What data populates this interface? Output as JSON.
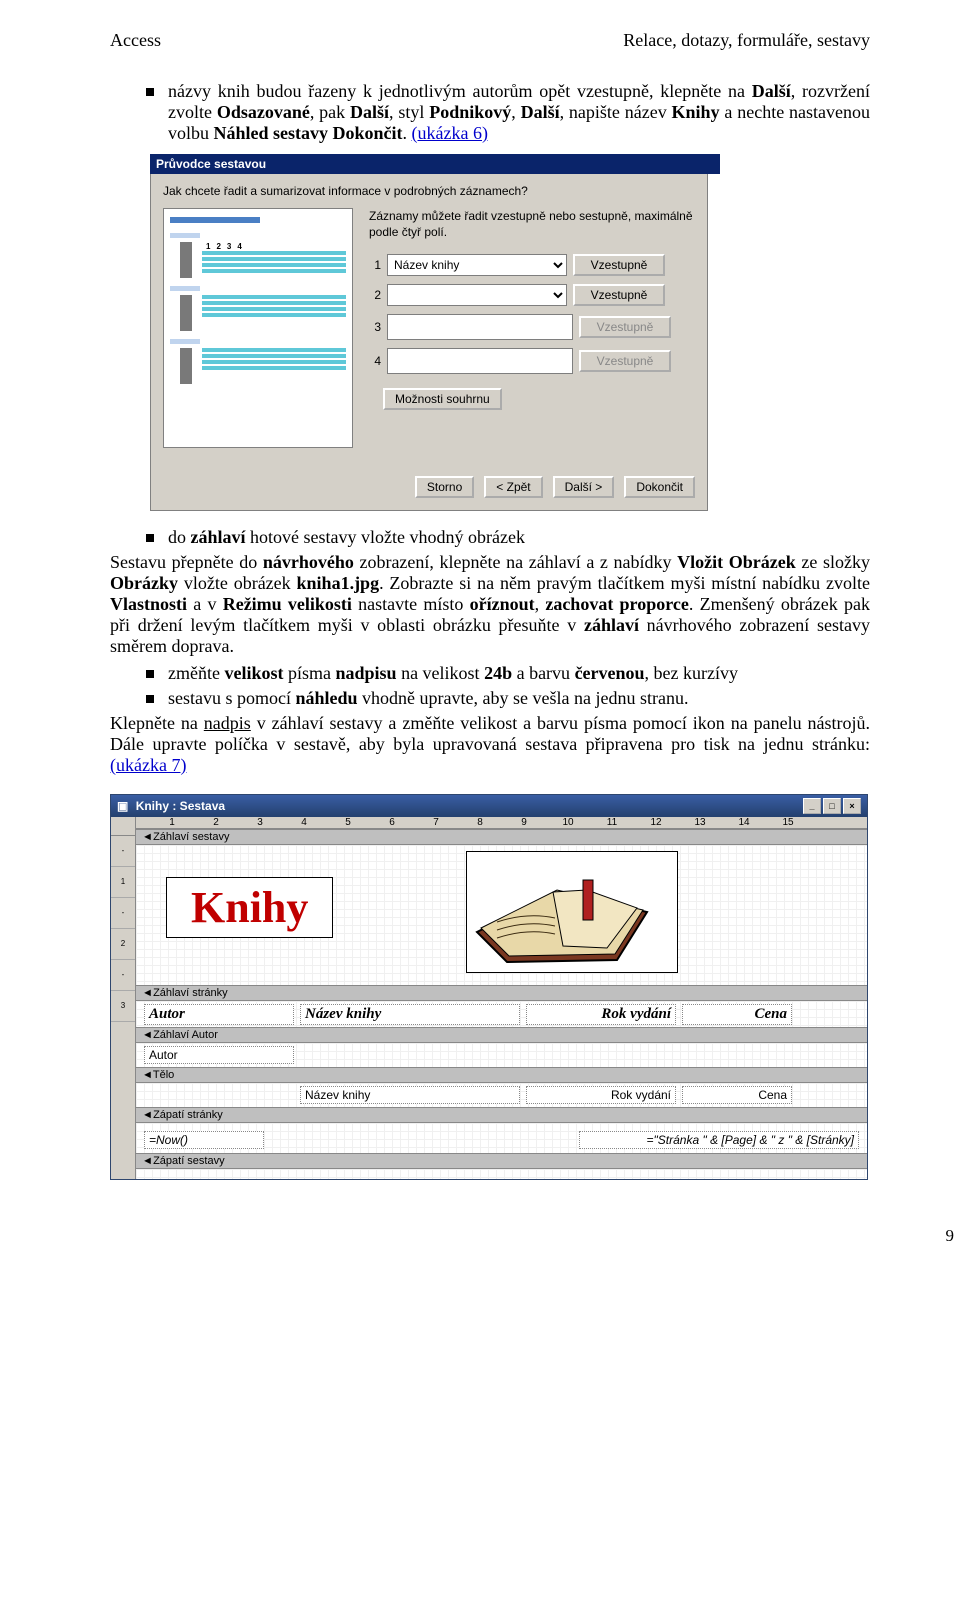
{
  "header": {
    "left": "Access",
    "right": "Relace, dotazy, formuláře, sestavy"
  },
  "bullet1": {
    "pre": "názvy knih budou řazeny k jednotlivým autorům opět vzestupně, klepněte na ",
    "b1": "Další",
    "mid1": ", rozvržení zvolte ",
    "b2": "Odsazované",
    "mid2": ", pak ",
    "b3": "Další",
    "mid3": ", styl ",
    "b4": "Podnikový",
    "mid4": ", ",
    "b5": "Další",
    "mid5": ", napište název ",
    "b6": "Knihy",
    "mid6": " a nechte nastavenou volbu ",
    "b7": "Náhled sestavy Dokončit",
    "post": ". ",
    "link": "(ukázka 6)"
  },
  "wizard": {
    "title": "Průvodce sestavou",
    "question": "Jak chcete řadit a sumarizovat informace v podrobných záznamech?",
    "hint": "Záznamy můžete řadit vzestupně nebo sestupně, maximálně podle čtyř polí.",
    "rows": [
      {
        "n": "1",
        "value": "Název knihy",
        "btn": "Vzestupně",
        "enabled": true
      },
      {
        "n": "2",
        "value": "",
        "btn": "Vzestupně",
        "enabled": true
      },
      {
        "n": "3",
        "value": "",
        "btn": "Vzestupně",
        "enabled": false
      },
      {
        "n": "4",
        "value": "",
        "btn": "Vzestupně",
        "enabled": false
      }
    ],
    "summary": "Možnosti souhrnu",
    "buttons": {
      "cancel": "Storno",
      "back": "< Zpět",
      "next": "Další >",
      "finish": "Dokončit"
    },
    "preview_numbers": [
      "1",
      "2",
      "3",
      "4"
    ]
  },
  "after_wizard": {
    "bullet2_pre": "do ",
    "bullet2_b1": "záhlaví",
    "bullet2_post": " hotové sestavy vložte vhodný obrázek",
    "para1a": "Sestavu přepněte do ",
    "para1b": "návrhového",
    "para1c": " zobrazení, klepněte na záhlaví a z nabídky ",
    "para1d": "Vložit Obrázek",
    "para1e": " ze složky ",
    "para1f": "Obrázky",
    "para1g": " vložte obrázek ",
    "para1h": "kniha1.jpg",
    "para1i": ". Zobrazte si na něm pravým tlačítkem myši místní nabídku zvolte ",
    "para1j": "Vlastnosti",
    "para1k": " a v ",
    "para1l": "Režimu velikosti",
    "para1m": " nastavte místo ",
    "para1n": "oříznout",
    "para1o": ", ",
    "para1p": "zachovat proporce",
    "para1q": ". Zmenšený obrázek pak při držení levým tlačítkem myši v oblasti obrázku přesuňte v ",
    "para1r": "záhlaví",
    "para1s": " návrhového zobrazení sestavy směrem doprava.",
    "bullet3a": "změňte ",
    "bullet3b": "velikost",
    "bullet3c": " písma ",
    "bullet3d": "nadpisu",
    "bullet3e": " na velikost ",
    "bullet3f": "24b",
    "bullet3g": " a barvu ",
    "bullet3h": "červenou",
    "bullet3i": ", bez kurzívy",
    "bullet4a": "sestavu s pomocí ",
    "bullet4b": "náhledu",
    "bullet4c": " vhodně upravte, aby se vešla na jednu stranu.",
    "para2a": "Klepněte na ",
    "para2b": "nadpis",
    "para2c": " v záhlaví sestavy a změňte velikost a barvu písma pomocí ikon na panelu nástrojů. Dále upravte políčka v sestavě, aby byla upravovaná sestava připravena pro tisk na jednu stránku:",
    "para2link": "(ukázka 7)"
  },
  "report": {
    "title": "Knihy : Sestava",
    "win_min": "_",
    "win_max": "□",
    "win_close": "×",
    "ruler": [
      "1",
      "2",
      "3",
      "4",
      "5",
      "6",
      "7",
      "8",
      "9",
      "10",
      "11",
      "12",
      "13",
      "14",
      "15"
    ],
    "vruler": [
      "-",
      "1",
      "-",
      "2",
      "-",
      "3"
    ],
    "sections": {
      "s1": "Záhlaví sestavy",
      "s2": "Záhlaví stránky",
      "s3": "Záhlaví Autor",
      "s4": "Tělo",
      "s5": "Zápatí stránky",
      "s6": "Zápatí sestavy"
    },
    "bigtitle": "Knihy",
    "cols": {
      "c1": "Autor",
      "c2": "Název knihy",
      "c3": "Rok vydání",
      "c4": "Cena"
    },
    "autor_field": "Autor",
    "body": {
      "c2": "Název knihy",
      "c3": "Rok vydání",
      "c4": "Cena"
    },
    "footer": {
      "left": "=Now()",
      "right": "=\"Stránka \" & [Page] & \" z \" & [Stránky]"
    }
  },
  "page_number": "9"
}
